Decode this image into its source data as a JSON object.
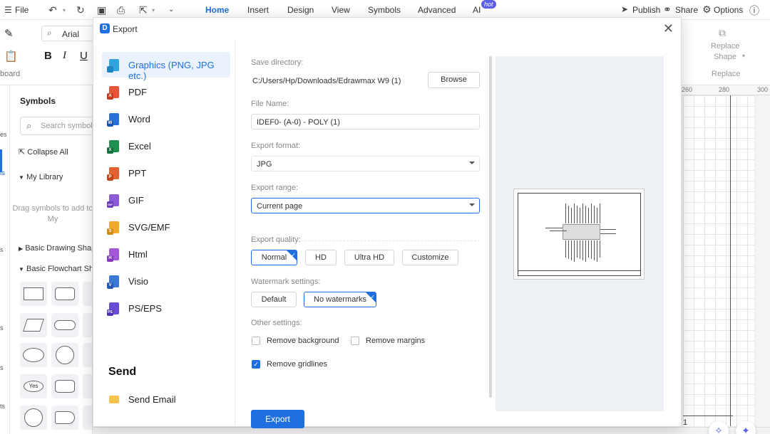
{
  "app": {
    "menu": {
      "file": "File",
      "tabs": [
        "Home",
        "Insert",
        "Design",
        "View",
        "Symbols",
        "Advanced",
        "AI"
      ],
      "active_tab": "Home",
      "ai_badge": "hot",
      "publish": "Publish",
      "share": "Share",
      "options": "Options"
    },
    "ribbon": {
      "font_name": "Arial",
      "bold": "B",
      "italic": "I",
      "underline": "U",
      "clipboard_label": "board",
      "replace_shape": "Replace Shape",
      "replace_group": "Replace"
    },
    "left_rail": [
      "es",
      "ts",
      "s",
      "s",
      "s",
      "ts"
    ],
    "symbols_panel": {
      "title": "Symbols",
      "search_placeholder": "Search symbols",
      "collapse_all": "Collapse All",
      "my_library": "My Library",
      "drag_hint": "Drag symbols to add to My",
      "basic_drawing": "Basic Drawing Shapes",
      "basic_flowchart": "Basic Flowchart Shapes",
      "yes_shape": "Yes"
    },
    "ruler": [
      "260",
      "280",
      "300"
    ],
    "page_number": "1"
  },
  "dialog": {
    "title": "Export",
    "formats": [
      {
        "label": "Graphics (PNG, JPG etc.)",
        "color": "#2fa5e0",
        "badge": ""
      },
      {
        "label": "PDF",
        "color": "#e8543a",
        "badge": "A"
      },
      {
        "label": "Word",
        "color": "#2b6fd8",
        "badge": "W"
      },
      {
        "label": "Excel",
        "color": "#1f8f4e",
        "badge": "X"
      },
      {
        "label": "PPT",
        "color": "#e2612f",
        "badge": "P"
      },
      {
        "label": "GIF",
        "color": "#8d5ad6",
        "badge": "GIF"
      },
      {
        "label": "SVG/EMF",
        "color": "#f0a92a",
        "badge": "S"
      },
      {
        "label": "Html",
        "color": "#a356d8",
        "badge": "H"
      },
      {
        "label": "Visio",
        "color": "#3b76db",
        "badge": "V"
      },
      {
        "label": "PS/EPS",
        "color": "#6a4bd6",
        "badge": "PS"
      }
    ],
    "active_format": "Graphics (PNG, JPG etc.)",
    "send_heading": "Send",
    "send_email": "Send Email",
    "save_directory_label": "Save directory:",
    "save_directory": "C:/Users/Hp/Downloads/Edrawmax W9 (1)",
    "browse": "Browse",
    "file_name_label": "File Name:",
    "file_name": "IDEF0- (A-0) - POLY (1)",
    "export_format_label": "Export format:",
    "export_format": "JPG",
    "export_range_label": "Export range:",
    "export_range": "Current page",
    "export_quality_label": "Export quality:",
    "quality_options": [
      "Normal",
      "HD",
      "Ultra HD",
      "Customize"
    ],
    "quality_selected": "Normal",
    "watermark_label": "Watermark settings:",
    "watermark_options": [
      "Default",
      "No watermarks"
    ],
    "watermark_selected": "No watermarks",
    "other_label": "Other settings:",
    "remove_background": {
      "label": "Remove background",
      "checked": false
    },
    "remove_margins": {
      "label": "Remove margins",
      "checked": false
    },
    "remove_gridlines": {
      "label": "Remove gridlines",
      "checked": true
    },
    "export_button": "Export",
    "colors": {
      "accent": "#1f6fe0",
      "selected_bg": "#eaf2fd",
      "preview_bg": "#eef1f6"
    }
  }
}
